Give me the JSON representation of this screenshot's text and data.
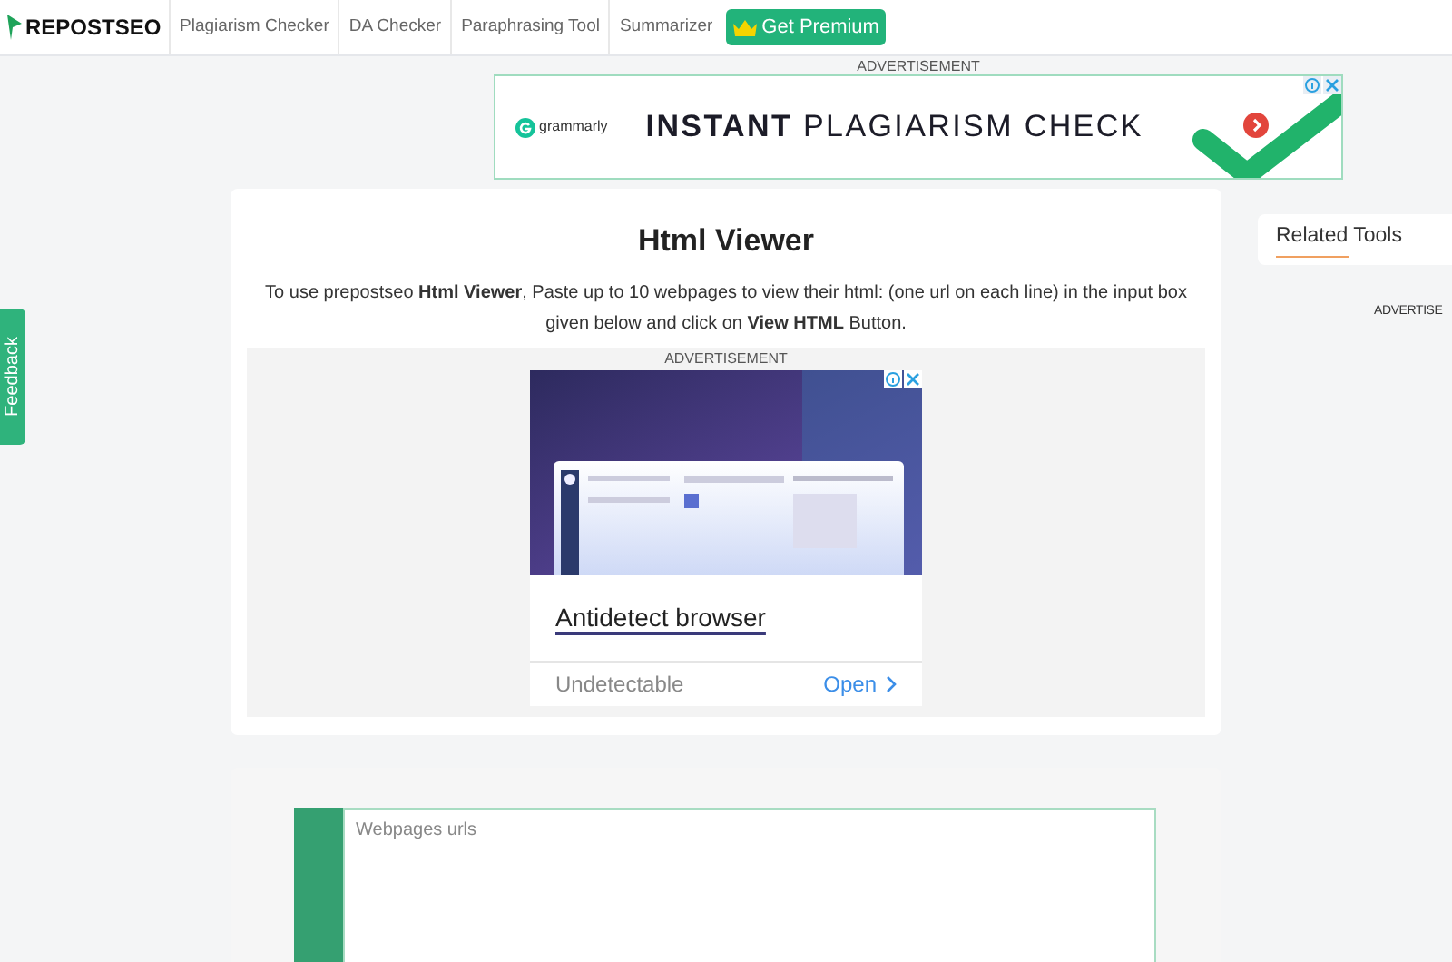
{
  "header": {
    "logo": "REPOSTSEO",
    "nav": [
      {
        "label": "Plagiarism Checker"
      },
      {
        "label": "DA Checker"
      },
      {
        "label": "Paraphrasing Tool"
      },
      {
        "label": "Summarizer"
      }
    ],
    "premium": "Get Premium"
  },
  "feedback": "Feedback",
  "top_ad": {
    "label": "ADVERTISEMENT",
    "brand": "grammarly",
    "headline_bold": "INSTANT",
    "headline": "PLAGIARISM CHECK"
  },
  "main": {
    "title": "Html Viewer",
    "intro": "To use prepostseo **Html Viewer**, Paste up to 10 webpages to view their html: (one url on each line) in the input box given below and click on **View HTML** Button.",
    "ad": {
      "label": "ADVERTISEMENT",
      "title": "Antidetect browser",
      "subtitle": "Undetectable",
      "action": "Open"
    },
    "input": {
      "placeholder": "Webpages urls"
    }
  },
  "sidebar": {
    "title": "Related Tools",
    "ad_label": "ADVERTISE"
  }
}
